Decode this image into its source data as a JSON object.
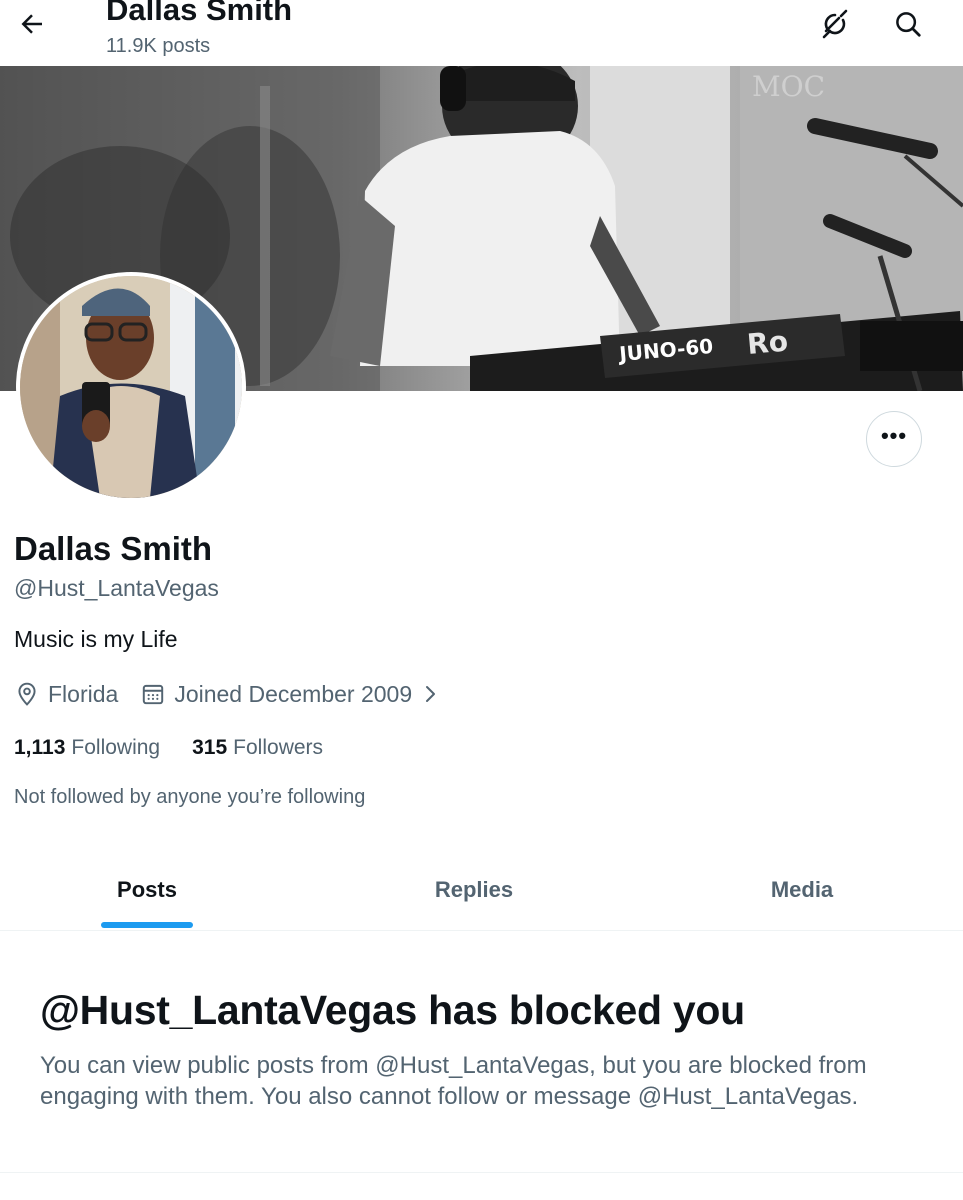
{
  "header": {
    "title": "Dallas Smith",
    "post_count": "11.9K posts"
  },
  "profile": {
    "name": "Dallas Smith",
    "handle": "@Hust_LantaVegas",
    "bio": "Music is my Life",
    "location": "Florida",
    "joined": "Joined December 2009",
    "following_count": "1,113",
    "following_label": "Following",
    "followers_count": "315",
    "followers_label": "Followers",
    "followed_by": "Not followed by anyone you’re following"
  },
  "banner": {
    "keyboard_label": "JUNO-60",
    "brand_label": "Ro"
  },
  "tabs": [
    {
      "label": "Posts",
      "active": true
    },
    {
      "label": "Replies",
      "active": false
    },
    {
      "label": "Media",
      "active": false
    }
  ],
  "blocked_notice": {
    "title": "@Hust_LantaVegas has blocked you",
    "body": "You can view public posts from @Hust_LantaVegas, but you are blocked from engaging with them. You also cannot follow or message @Hust_LantaVegas."
  },
  "icons": {
    "back": "arrow-left-icon",
    "grok": "grok-icon",
    "search": "search-icon",
    "more": "more-horizontal-icon",
    "location": "location-pin-icon",
    "calendar": "calendar-icon",
    "chevron": "chevron-right-icon"
  },
  "colors": {
    "accent": "#1d9bf0",
    "secondary_text": "#536471",
    "primary_text": "#0f1419"
  }
}
